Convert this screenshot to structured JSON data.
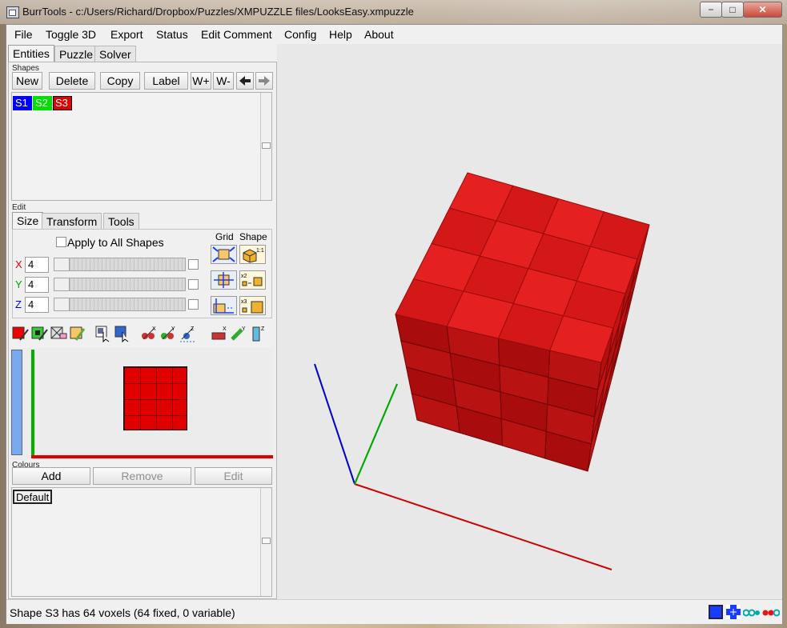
{
  "window": {
    "title": "BurrTools - c:/Users/Richard/Dropbox/Puzzles/XMPUZZLE files/LooksEasy.xmpuzzle",
    "minimize": "−",
    "maximize": "□",
    "close": "✕"
  },
  "menu": [
    "File",
    "Toggle 3D",
    "Export",
    "Status",
    "Edit Comment",
    "Config",
    "Help",
    "About"
  ],
  "main_tabs": [
    "Entities",
    "Puzzle",
    "Solver"
  ],
  "shapes": {
    "group_label": "Shapes",
    "buttons": [
      "New",
      "Delete",
      "Copy",
      "Label",
      "W+",
      "W-"
    ],
    "prev_arrow": "🡸",
    "next_arrow": "🡺",
    "items": [
      {
        "label": "S1",
        "color": "#0000ff",
        "text_color": "#ffffff"
      },
      {
        "label": "S2",
        "color": "#00e000",
        "text_color": "#ffffff"
      },
      {
        "label": "S3",
        "color": "#e00000",
        "text_color": "#ffffff",
        "selected": true
      }
    ]
  },
  "edit": {
    "group_label": "Edit",
    "tabs": [
      "Size",
      "Transform",
      "Tools"
    ],
    "apply_all": "Apply to All Shapes",
    "grid_label": "Grid",
    "shape_label": "Shape",
    "axes": [
      {
        "name": "X",
        "value": "4",
        "color": "#e00000"
      },
      {
        "name": "Y",
        "value": "4",
        "color": "#00a000"
      },
      {
        "name": "Z",
        "value": "4",
        "color": "#0000d0"
      }
    ],
    "grid_icon_labels": [
      "1:1",
      "x2",
      "x3"
    ]
  },
  "colours": {
    "group_label": "Colours",
    "add": "Add",
    "remove": "Remove",
    "edit": "Edit",
    "items": [
      "Default"
    ]
  },
  "status": {
    "text": "Shape S3 has 64 voxels (64 fixed, 0 variable)"
  },
  "colors": {
    "cube_red": "#d71a1a",
    "axis_x": "#cc0000",
    "axis_y": "#00aa00",
    "axis_z": "#0000cc"
  }
}
